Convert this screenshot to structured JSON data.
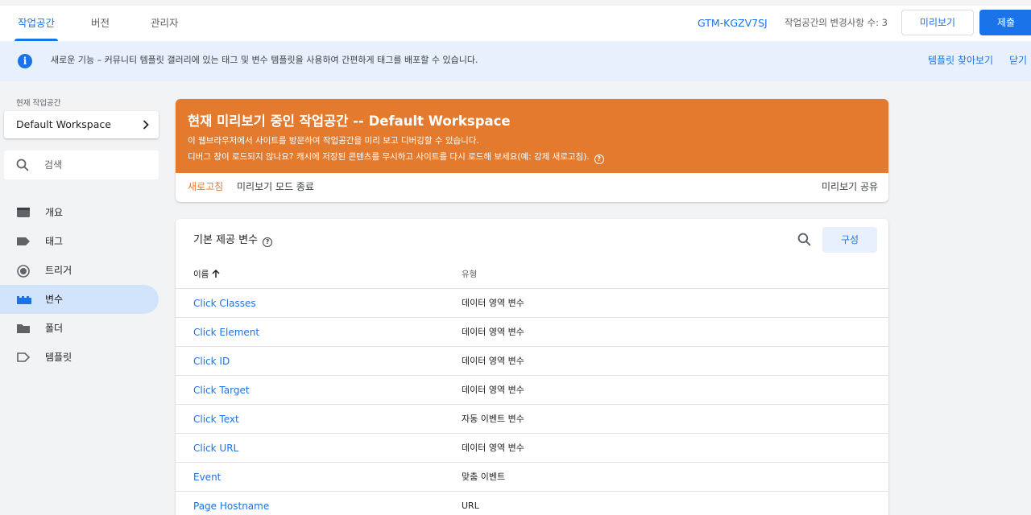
{
  "topbar": {
    "tabs": [
      {
        "label": "작업공간",
        "active": true
      },
      {
        "label": "버전",
        "active": false
      },
      {
        "label": "관리자",
        "active": false
      }
    ],
    "container_id": "GTM-KGZV7SJ",
    "changes_label": "작업공간의 변경사항 수: 3",
    "preview_label": "미리보기",
    "submit_label": "제출"
  },
  "banner": {
    "text": "새로운 기능 – 커뮤니티 템플릿 갤러리에 있는 태그 및 변수 템플릿을 사용하여 간편하게 태그를 배포할 수 있습니다.",
    "explore_label": "템플릿 찾아보기",
    "close_label": "닫기"
  },
  "sidebar": {
    "workspace_caption": "현재 작업공간",
    "workspace_name": "Default Workspace",
    "search_placeholder": "검색",
    "items": [
      {
        "label": "개요",
        "icon": "overview-icon"
      },
      {
        "label": "태그",
        "icon": "tag-icon"
      },
      {
        "label": "트리거",
        "icon": "trigger-icon"
      },
      {
        "label": "변수",
        "icon": "variable-icon",
        "active": true
      },
      {
        "label": "폴더",
        "icon": "folder-icon"
      },
      {
        "label": "템플릿",
        "icon": "template-icon"
      }
    ]
  },
  "preview_card": {
    "title": "현재 미리보기 중인 작업공간 -- Default Workspace",
    "line1": "이 웹브라우저에서 사이트를 방문하여 작업공간을 미리 보고 디버깅할 수 있습니다.",
    "line2": "디버그 창이 로드되지 않나요? 캐시에 저장된 콘텐츠를 무시하고 사이트를 다시 로드해 보세요(예: 강제 새로고침).",
    "refresh_label": "새로고침",
    "exit_label": "미리보기 모드 종료",
    "share_label": "미리보기 공유",
    "accent": "#e37a2e"
  },
  "variables": {
    "title": "기본 제공 변수",
    "configure_label": "구성",
    "columns": {
      "name": "이름",
      "type": "유형"
    },
    "rows": [
      {
        "name": "Click Classes",
        "type": "데이터 영역 변수"
      },
      {
        "name": "Click Element",
        "type": "데이터 영역 변수"
      },
      {
        "name": "Click ID",
        "type": "데이터 영역 변수"
      },
      {
        "name": "Click Target",
        "type": "데이터 영역 변수"
      },
      {
        "name": "Click Text",
        "type": "자동 이벤트 변수"
      },
      {
        "name": "Click URL",
        "type": "데이터 영역 변수"
      },
      {
        "name": "Event",
        "type": "맞춤 이벤트"
      },
      {
        "name": "Page Hostname",
        "type": "URL"
      }
    ]
  },
  "colors": {
    "primary": "#1a73e8",
    "accent": "#e37a2e",
    "active_nav": "#d2e3fc"
  }
}
